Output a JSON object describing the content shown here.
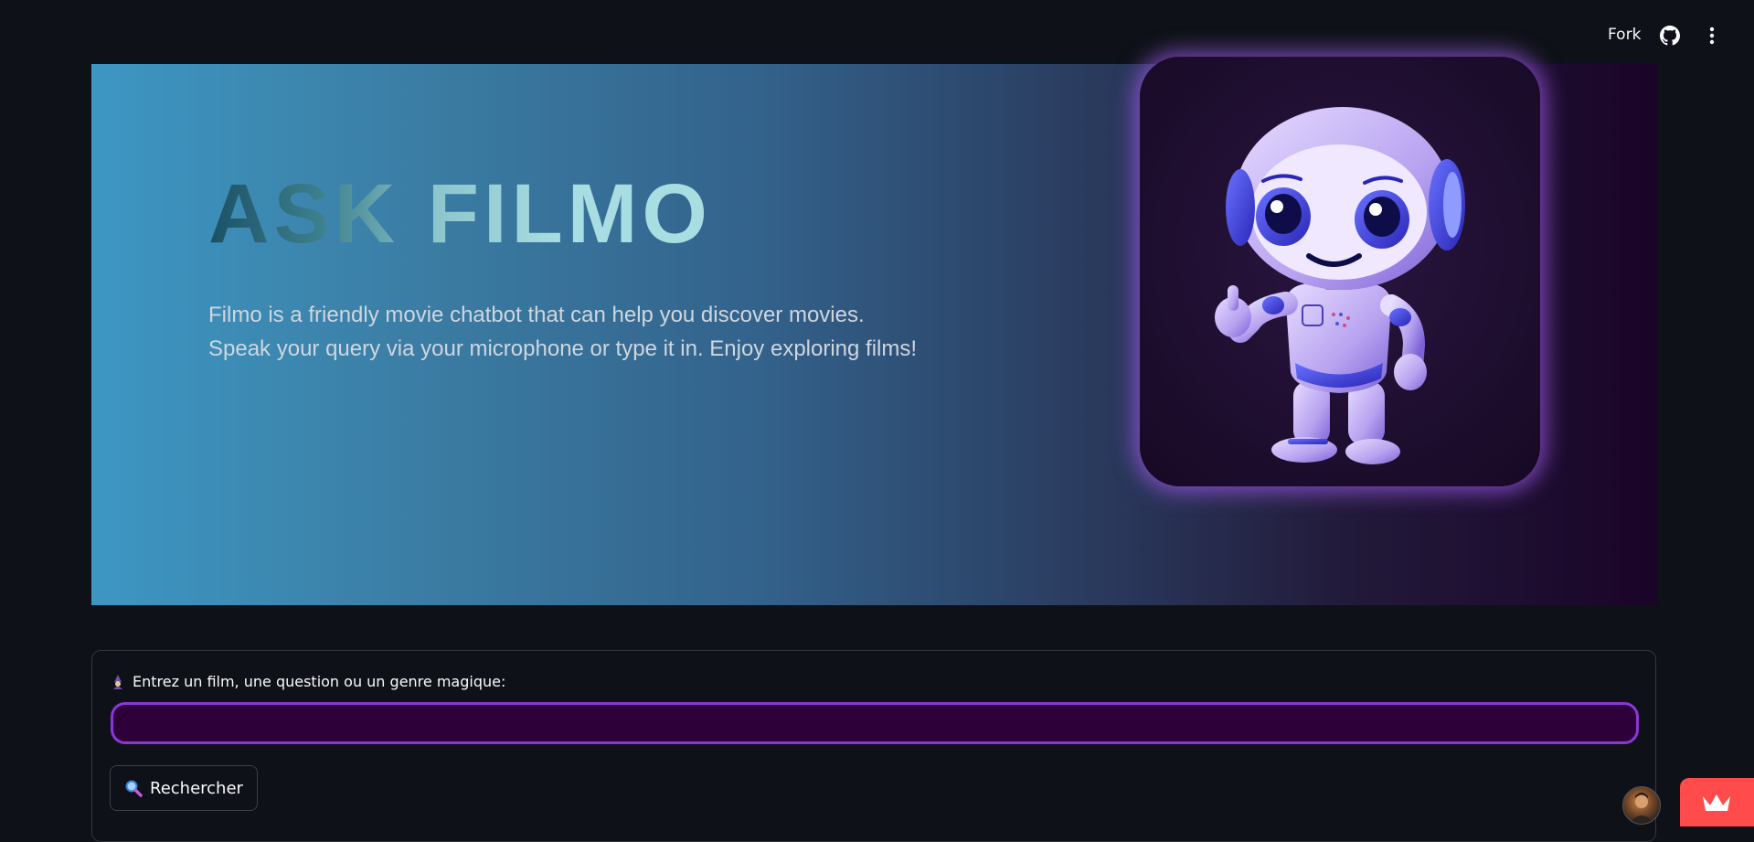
{
  "header": {
    "fork_label": "Fork",
    "github_icon": "github-icon",
    "menu_icon": "kebab-menu-icon"
  },
  "hero": {
    "title": "ASK FILMO",
    "description_line1": "Filmo is a friendly movie chatbot that can help you discover movies.",
    "description_line2": "Speak your query via your microphone or type it in. Enjoy exploring films!",
    "image_icon": "robot-mascot-icon",
    "colors": {
      "gradient_start": "#3d97c3",
      "gradient_end": "#1a0428",
      "card_glow": "#9b5ae6"
    }
  },
  "search": {
    "label": "Entrez un film, une question ou un genre magique:",
    "label_icon": "wizard-icon",
    "input_value": "",
    "input_placeholder": "",
    "button_label": "Rechercher",
    "button_icon": "magnifying-glass-icon",
    "colors": {
      "input_bg": "#2e0039",
      "input_border": "#8b36d9"
    }
  },
  "footer": {
    "avatar_icon": "user-avatar",
    "badge_icon": "streamlit-crown-icon",
    "badge_color": "#ff4b4b"
  }
}
